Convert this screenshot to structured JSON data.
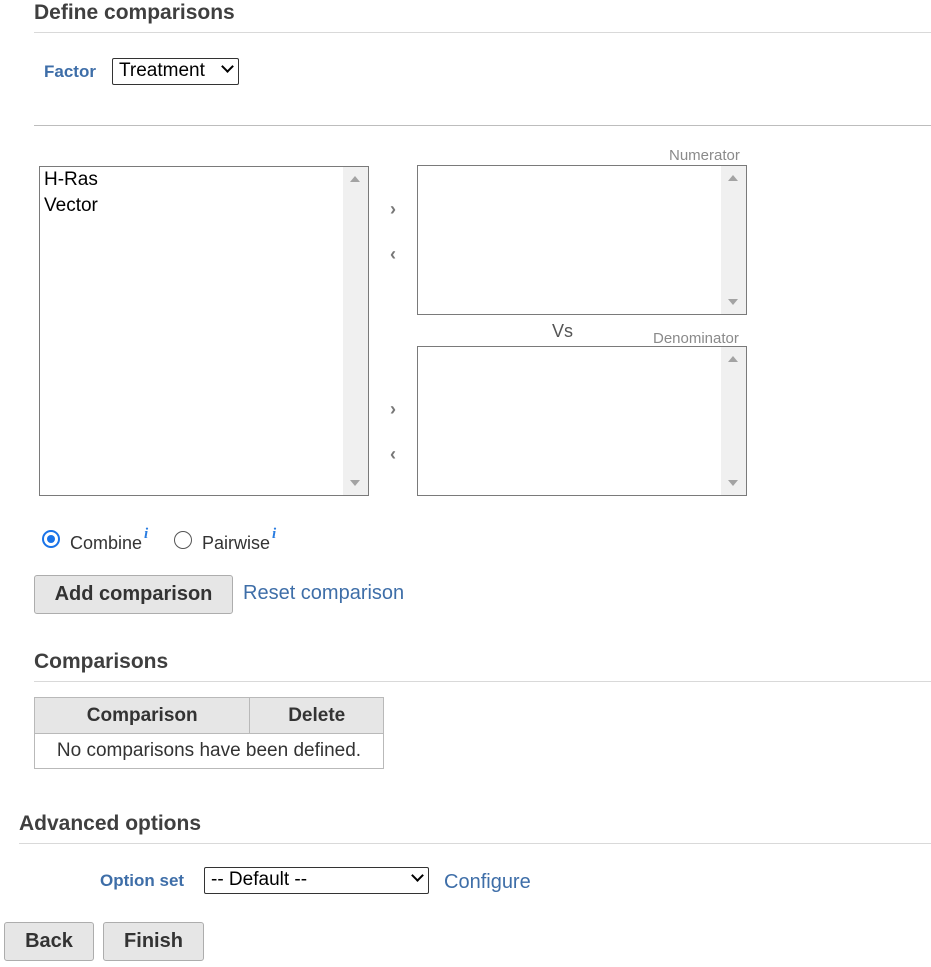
{
  "define_section": {
    "title": "Define comparisons"
  },
  "factor": {
    "label": "Factor",
    "selected": "Treatment"
  },
  "available_levels": [
    "H-Ras",
    "Vector"
  ],
  "numerator": {
    "label": "Numerator"
  },
  "vs_label": "Vs",
  "denominator": {
    "label": "Denominator"
  },
  "mode": {
    "combine_label": "Combine",
    "pairwise_label": "Pairwise",
    "info_glyph": "i",
    "selected": "Combine"
  },
  "actions": {
    "add_label": "Add comparison",
    "reset_label": "Reset comparison"
  },
  "comparisons_section": {
    "title": "Comparisons",
    "columns": [
      "Comparison",
      "Delete"
    ],
    "empty_message": "No comparisons have been defined."
  },
  "advanced_section": {
    "title": "Advanced options",
    "option_set_label": "Option set",
    "option_set_value": "-- Default --",
    "configure_label": "Configure"
  },
  "nav": {
    "back_label": "Back",
    "finish_label": "Finish"
  },
  "icons": {
    "move_right": "chevron-right-icon",
    "move_left": "chevron-left-icon",
    "info": "info-icon",
    "dropdown": "chevron-down-icon"
  },
  "colors": {
    "link": "#3e6ea8",
    "accent": "#1a73e8",
    "button_bg": "#e6e6e6"
  }
}
